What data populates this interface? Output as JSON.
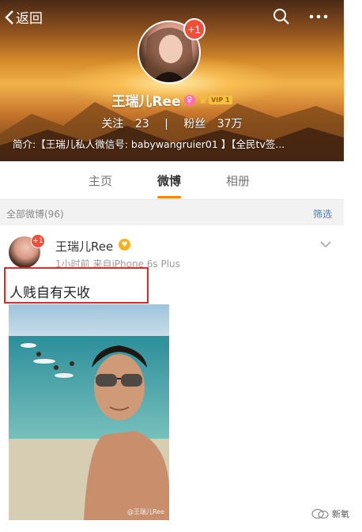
{
  "nav": {
    "back_label": "返回"
  },
  "profile": {
    "notification_badge": "+1",
    "name": "王瑞儿Ree",
    "gender_symbol": "♀",
    "vip_label": "VIP 1",
    "following_label": "关注",
    "following_count": "23",
    "separator": "|",
    "followers_label": "粉丝",
    "followers_count": "37万",
    "bio": "简介:【王瑞儿私人微信号: babywangruier01 】【全民tv签..."
  },
  "tabs": [
    {
      "label": "主页",
      "active": false
    },
    {
      "label": "微博",
      "active": true
    },
    {
      "label": "相册",
      "active": false
    }
  ],
  "filter_bar": {
    "all_label": "全部微博(96)",
    "filter_label": "筛选"
  },
  "post": {
    "avatar_badge": "+1",
    "author": "王瑞儿Ree",
    "author_emoji": "😍",
    "meta": "1小时前  来自iPhone 6s Plus",
    "text": "人贱自有天收",
    "image_watermark": "@王瑞儿Ree"
  },
  "footer": {
    "logo_text": "新氧"
  },
  "colors": {
    "accent": "#ff8200",
    "link": "#4a78b8",
    "highlight": "#e02a2a"
  }
}
